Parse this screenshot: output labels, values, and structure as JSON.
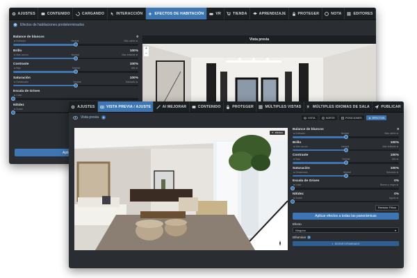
{
  "back": {
    "tabs": [
      {
        "label": "AJUSTES",
        "icon": "gear-icon",
        "active": false
      },
      {
        "label": "CONTENIDO",
        "icon": "content-icon",
        "active": false
      },
      {
        "label": "CARGANDO",
        "icon": "loading-icon",
        "active": false
      },
      {
        "label": "INTERACCIÓN",
        "icon": "interaction-icon",
        "active": false
      },
      {
        "label": "EFECTOS DE HABITACIÓN",
        "icon": "effects-icon",
        "active": true
      },
      {
        "label": "VR",
        "icon": "vr-icon",
        "active": false
      },
      {
        "label": "TIENDA",
        "icon": "cart-icon",
        "active": false
      },
      {
        "label": "APRENDIZAJE",
        "icon": "learning-icon",
        "active": false
      },
      {
        "label": "PROTEGER",
        "icon": "lock-icon",
        "active": false
      },
      {
        "label": "NOTA",
        "icon": "note-icon",
        "active": false
      },
      {
        "label": "EDITORES",
        "icon": "editors-icon",
        "active": false
      }
    ],
    "header": "Efectos de habitaciones predeterminados",
    "sliders": [
      {
        "label": "Balance de blancos",
        "value": "0",
        "left": "◄ Enfriador",
        "mid": "Neutral",
        "right": "Más cálido ►",
        "pos": 0.5
      },
      {
        "label": "Brillo",
        "value": "100%",
        "left": "◄ Más oscuro",
        "mid": "Neutral",
        "right": "Más brillante ►",
        "pos": 0.5
      },
      {
        "label": "Contraste",
        "value": "100%",
        "left": "◄ Bajo",
        "mid": "Normal",
        "right": "Alto ►",
        "pos": 0.5
      },
      {
        "label": "Saturación",
        "value": "100%",
        "left": "◄ Desaturado",
        "mid": "Neutral",
        "right": "Saturado ►",
        "pos": 0.5
      },
      {
        "label": "Escala de Grises",
        "value": "",
        "left": "◄ Color",
        "mid": "",
        "right": "",
        "pos": 0.0
      },
      {
        "label": "Nitidez",
        "value": "",
        "left": "◄ Suave",
        "mid": "",
        "right": "",
        "pos": 0.0
      }
    ],
    "apply_label": "Aplicar efectos a",
    "preview_title": "Vista previa",
    "zoom_in": "+",
    "zoom_out": "−"
  },
  "front": {
    "tabs": [
      {
        "label": "AJUSTES",
        "icon": "gear-icon",
        "active": false
      },
      {
        "label": "VISTA PREVIA / AJUSTE",
        "icon": "eye-icon",
        "active": true
      },
      {
        "label": "AI MEJORAR",
        "icon": "wand-icon",
        "active": false
      },
      {
        "label": "CONTENIDO",
        "icon": "content-icon",
        "active": false
      },
      {
        "label": "PROTEGER",
        "icon": "lock-icon",
        "active": false
      },
      {
        "label": "MÚLTIPLES VISTAS",
        "icon": "views-icon",
        "active": false
      },
      {
        "label": "MÚLTIPLES IDIOMAS DE SALA",
        "icon": "language-icon",
        "active": false
      },
      {
        "label": "PUBLICAR",
        "icon": "publish-icon",
        "active": false
      }
    ],
    "header": "Vista previa",
    "mini_tabs": [
      {
        "label": "VISTA",
        "icon": "eye-icon",
        "active": false
      },
      {
        "label": "NORTE",
        "icon": "compass-icon",
        "active": false
      },
      {
        "label": "POSICIONES",
        "icon": "positions-icon",
        "active": false
      },
      {
        "label": "EFECTOS",
        "icon": "effects-icon",
        "active": true
      }
    ],
    "image_badge": "efectos",
    "sliders": [
      {
        "label": "Balance de blancos",
        "value": "0",
        "left": "◄ Enfriador",
        "mid": "Neutral",
        "right": "Más cálido ►",
        "pos": 0.5
      },
      {
        "label": "Brillo",
        "value": "100%",
        "left": "◄ Más oscuro",
        "mid": "Neutral",
        "right": "Más brillante ►",
        "pos": 0.5
      },
      {
        "label": "Contraste",
        "value": "100%",
        "left": "◄ Bajo",
        "mid": "Normal",
        "right": "Alto ►",
        "pos": 0.5
      },
      {
        "label": "Saturación",
        "value": "100%",
        "left": "◄ Desaturado",
        "mid": "Neutral",
        "right": "Saturado ►",
        "pos": 0.5
      },
      {
        "label": "Escala de Grises",
        "value": "0%",
        "left": "◄ Color",
        "mid": "",
        "right": "Blanco y negro ►",
        "pos": 0.0
      },
      {
        "label": "Nitidez",
        "value": "0%",
        "left": "◄ Suave",
        "mid": "",
        "right": "Agudo ►",
        "pos": 0.0
      }
    ],
    "reset_label": "Reiniciar Filtros",
    "apply_label": "Aplicar efectos a todas las panorámicas",
    "effect_label": "Efecto",
    "effect_value": "Ninguno",
    "blur_label": "Difuminar",
    "blur_button": "EDITAR DIFUMINADO"
  }
}
